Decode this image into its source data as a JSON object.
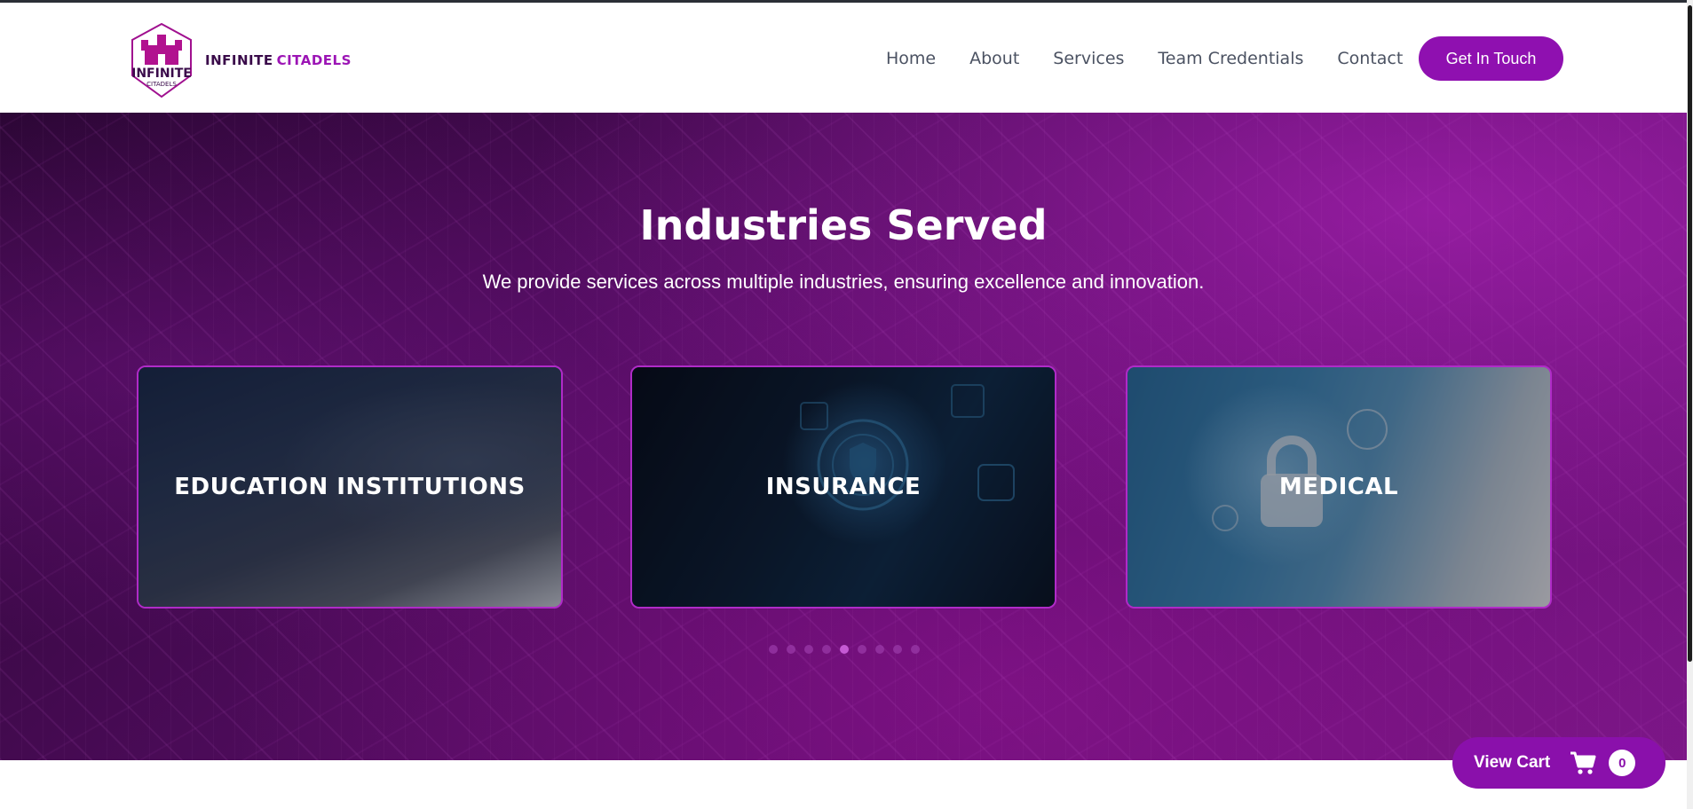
{
  "header": {
    "logo": {
      "word1": "INFINITE",
      "word2": "CITADELS",
      "mark_line1": "INFINITE",
      "mark_line2": "CITADELS"
    },
    "nav": [
      {
        "label": "Home"
      },
      {
        "label": "About"
      },
      {
        "label": "Services"
      },
      {
        "label": "Team Credentials"
      },
      {
        "label": "Contact"
      }
    ],
    "cta_label": "Get In Touch"
  },
  "hero": {
    "title": "Industries Served",
    "subtitle": "We provide services across multiple industries, ensuring excellence and innovation.",
    "cards": [
      {
        "title": "EDUCATION INSTITUTIONS"
      },
      {
        "title": "INSURANCE"
      },
      {
        "title": "MEDICAL"
      }
    ],
    "carousel": {
      "total_dots": 9,
      "active_dot": 5
    }
  },
  "cart": {
    "label": "View Cart",
    "count": "0",
    "icon": "shopping-cart-icon"
  },
  "colors": {
    "brand": "#8f10b0",
    "nav_text": "#4b5262",
    "hero_dark": "#2a0633"
  }
}
